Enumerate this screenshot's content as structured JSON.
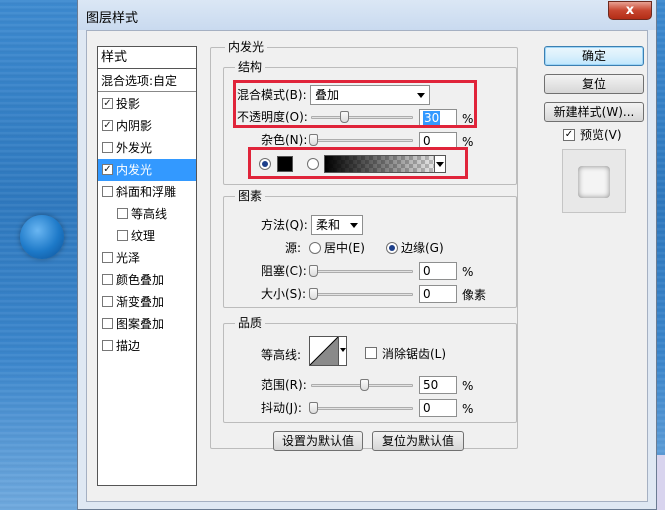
{
  "dialog": {
    "title": "图层样式",
    "close_glyph": "x"
  },
  "styles_list": {
    "header": "样式",
    "blend_options": "混合选项:自定",
    "items": [
      {
        "label": "投影",
        "checked": true,
        "check": "✓"
      },
      {
        "label": "内阴影",
        "checked": true,
        "check": "✓"
      },
      {
        "label": "外发光",
        "checked": false,
        "check": ""
      },
      {
        "label": "内发光",
        "checked": true,
        "check": "✓",
        "selected": true
      },
      {
        "label": "斜面和浮雕",
        "checked": false,
        "check": ""
      },
      {
        "label": "等高线",
        "checked": false,
        "check": "",
        "indent": true
      },
      {
        "label": "纹理",
        "checked": false,
        "check": "",
        "indent": true
      },
      {
        "label": "光泽",
        "checked": false,
        "check": ""
      },
      {
        "label": "颜色叠加",
        "checked": false,
        "check": ""
      },
      {
        "label": "渐变叠加",
        "checked": false,
        "check": ""
      },
      {
        "label": "图案叠加",
        "checked": false,
        "check": ""
      },
      {
        "label": "描边",
        "checked": false,
        "check": ""
      }
    ]
  },
  "inner_glow": {
    "title": "内发光",
    "structure": {
      "title": "结构",
      "blend_mode_label": "混合模式(B):",
      "blend_mode_value": "叠加",
      "opacity_label": "不透明度(O):",
      "opacity_value": "30",
      "opacity_fraction": 0.3,
      "noise_label": "杂色(N):",
      "noise_value": "0",
      "noise_fraction": 0,
      "percent": "%",
      "color_mode": "solid",
      "glow_color": "#000000"
    },
    "elements": {
      "title": "图素",
      "technique_label": "方法(Q):",
      "technique_value": "柔和",
      "source_label": "源:",
      "source_center": "居中(E)",
      "source_edge": "边缘(G)",
      "source_selected": "edge",
      "choke_label": "阻塞(C):",
      "choke_value": "0",
      "size_label": "大小(S):",
      "size_value": "0",
      "percent": "%",
      "pixels": "像素"
    },
    "quality": {
      "title": "品质",
      "contour_label": "等高线:",
      "anti_alias_label": "消除锯齿(L)",
      "anti_alias_checked": false,
      "range_label": "范围(R):",
      "range_value": "50",
      "range_fraction": 0.5,
      "jitter_label": "抖动(J):",
      "jitter_value": "0",
      "jitter_fraction": 0,
      "percent": "%"
    },
    "make_default_button": "设置为默认值",
    "reset_default_button": "复位为默认值"
  },
  "buttons": {
    "ok": "确定",
    "reset": "复位",
    "new_style": "新建样式(W)...",
    "preview_label": "预览(V)",
    "preview_checked": true,
    "preview_check": "✓"
  },
  "colors": {
    "highlight_red": "#e0243a",
    "selection_blue": "#3399ff"
  }
}
